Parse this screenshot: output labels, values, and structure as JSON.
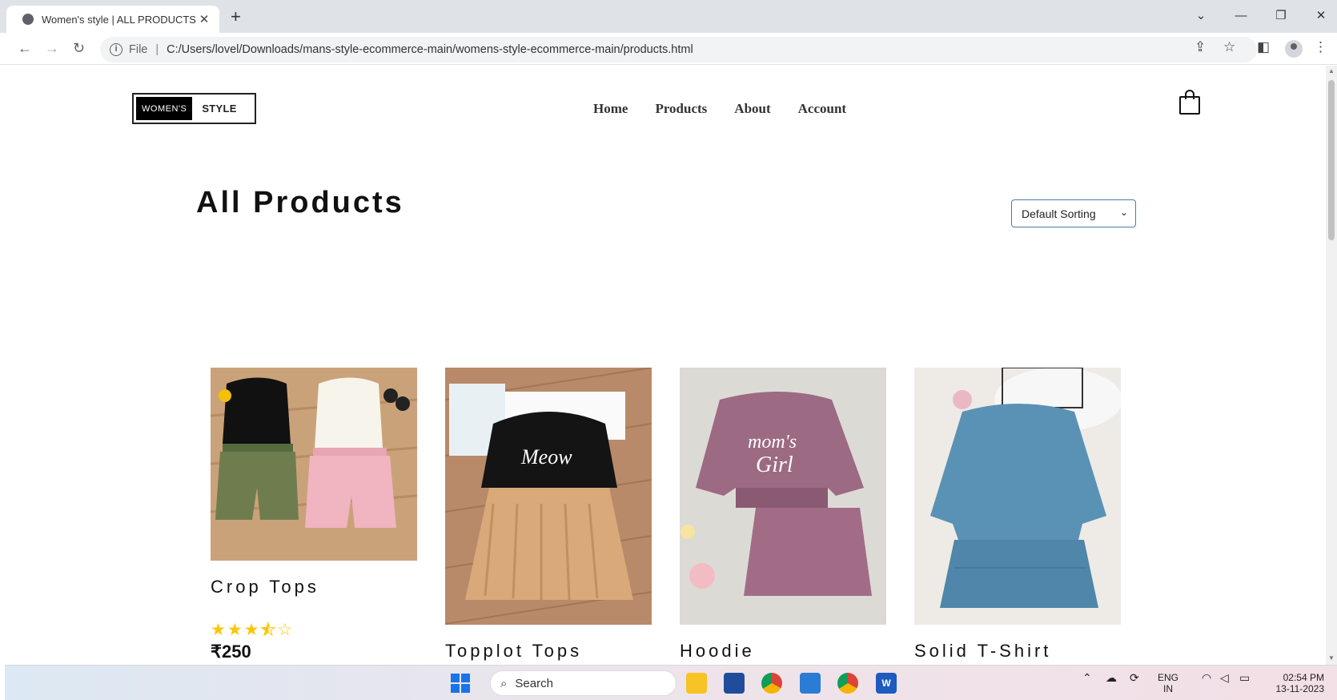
{
  "browser": {
    "tab_title": "Women's style | ALL PRODUCTS",
    "tab_close": "✕",
    "new_tab": "+",
    "file_label": "File",
    "separator": "|",
    "url": "C:/Users/lovel/Downloads/mans-style-ecommerce-main/womens-style-ecommerce-main/products.html",
    "icons": [
      "back-icon",
      "forward-icon",
      "reload-icon",
      "info-icon",
      "share-icon",
      "bookmark-star-icon",
      "side-panel-icon",
      "profile-icon",
      "menu-icon"
    ]
  },
  "site": {
    "logo_left": "WOMEN'S",
    "logo_right": "STYLE",
    "nav": [
      "Home",
      "Products",
      "About",
      "Account"
    ],
    "heading": "All Products",
    "sort_selected": "Default Sorting",
    "products": [
      {
        "name": "Crop Tops",
        "rating": 3.5,
        "max_rating": 5,
        "price": "₹250"
      },
      {
        "name": "Topplot Tops"
      },
      {
        "name": "Hoodie"
      },
      {
        "name": "Solid T-Shirt"
      }
    ]
  },
  "taskbar": {
    "search_placeholder": "Search",
    "lang_line1": "ENG",
    "lang_line2": "IN",
    "time": "02:54 PM",
    "date": "13-11-2023"
  }
}
